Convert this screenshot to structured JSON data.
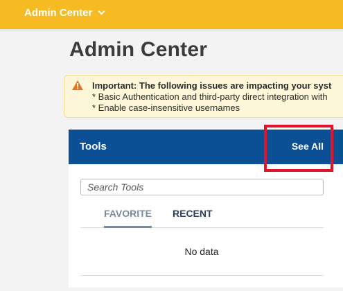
{
  "header": {
    "menu_label": "Admin Center",
    "menu_icon": "chevron-down-icon",
    "bar_color": "#f6bb23"
  },
  "page": {
    "title": "Admin Center"
  },
  "notice": {
    "icon": "warning-icon",
    "line1": "Important: The following issues are impacting your syst",
    "line2": "* Basic Authentication and third-party direct integration with",
    "line3": "* Enable case-insensitive usernames",
    "background": "#fdf6d9"
  },
  "tools": {
    "title": "Tools",
    "see_all_label": "See All",
    "header_color": "#0b4f95",
    "search_placeholder": "Search Tools",
    "tabs": [
      {
        "label": "FAVORITE",
        "selected": true
      },
      {
        "label": "RECENT",
        "selected": false
      }
    ],
    "empty_text": "No data"
  },
  "highlight_color": "#e1122b"
}
